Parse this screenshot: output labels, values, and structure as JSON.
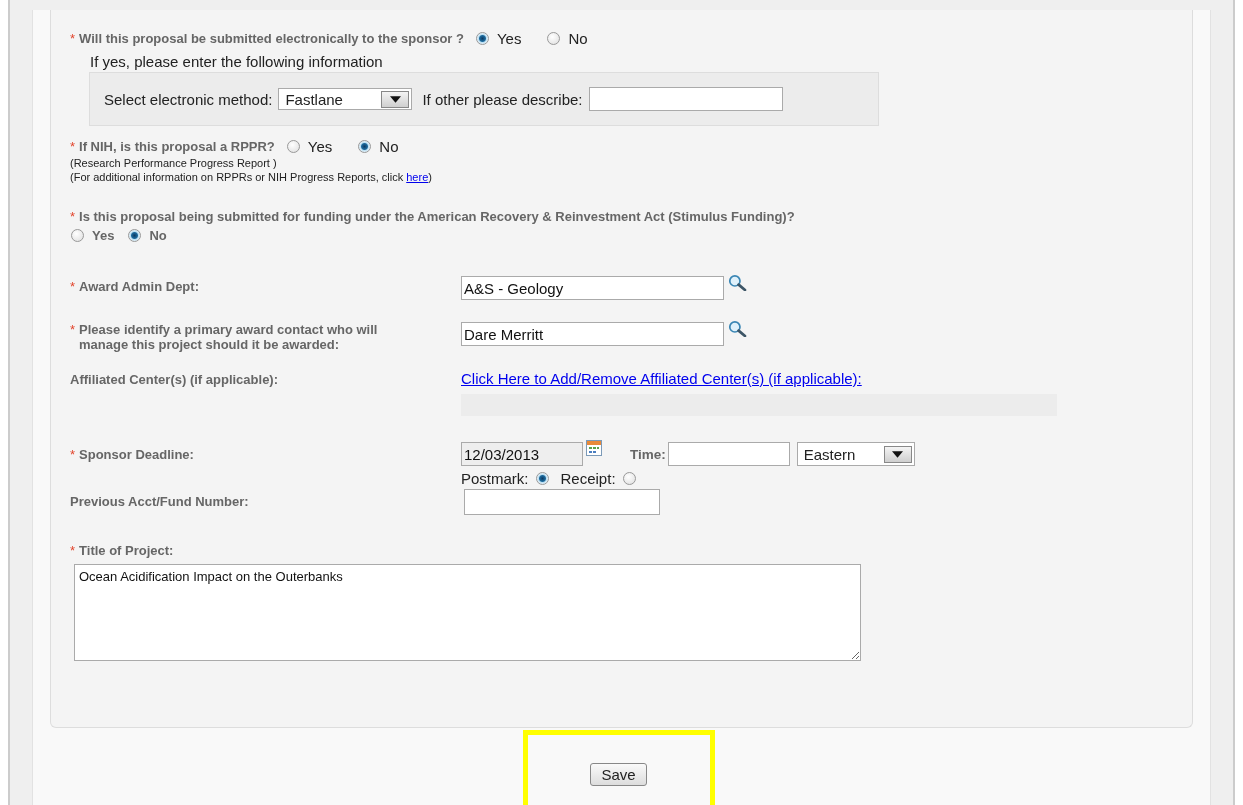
{
  "electronic_submission": {
    "required": "*",
    "question": "Will this proposal be submitted electronically to the sponsor ?",
    "options": [
      {
        "label": "Yes",
        "selected": true
      },
      {
        "label": "No",
        "selected": false
      }
    ],
    "hint": "If yes, please enter the following information",
    "method_label": "Select electronic method:",
    "method_value": "Fastlane",
    "other_label": "If other please describe:"
  },
  "nih": {
    "required": "*",
    "question": "If NIH, is this proposal a RPPR?",
    "options": [
      {
        "label": "Yes",
        "selected": false
      },
      {
        "label": "No",
        "selected": true
      }
    ],
    "note": "(Research Performance Progress Report )",
    "info_text": "(For additional information on RPPRs or NIH Progress Reports, click",
    "info_link": "here",
    "info_end": ")"
  },
  "arra": {
    "required": "*",
    "question": "Is this proposal being submitted for funding under the American Recovery & Reinvestment Act (Stimulus Funding)?",
    "options": [
      {
        "label": "Yes",
        "selected": false
      },
      {
        "label": "No",
        "selected": true
      }
    ]
  },
  "fields": [
    {
      "kind": "lookup",
      "required": "*",
      "label": "Award Admin Dept:",
      "value": "A&S - Geology"
    },
    {
      "kind": "lookup",
      "required": "*",
      "label": "Please identify a primary award contact who will manage this project should it be awarded:",
      "value": "Dare Merritt"
    },
    {
      "kind": "link",
      "label": "Affiliated Center(s) (if applicable):",
      "link": "Click Here to Add/Remove Affiliated Center(s) (if applicable):"
    },
    {
      "kind": "deadline",
      "required": "*",
      "label": "Sponsor Deadline:",
      "value": "12/03/2013",
      "time_label": "Time:",
      "timezone": "Eastern",
      "options": [
        {
          "label": "Postmark:",
          "selected": true
        },
        {
          "label": "Receipt:",
          "selected": false
        }
      ]
    },
    {
      "kind": "text",
      "label": "Previous Acct/Fund Number:"
    },
    {
      "kind": "textarea",
      "required": "*",
      "label": "Title of Project:",
      "value": "Ocean Acidification Impact on the Outerbanks"
    }
  ],
  "save_button": {
    "label": "Save",
    "highlighted": true
  }
}
